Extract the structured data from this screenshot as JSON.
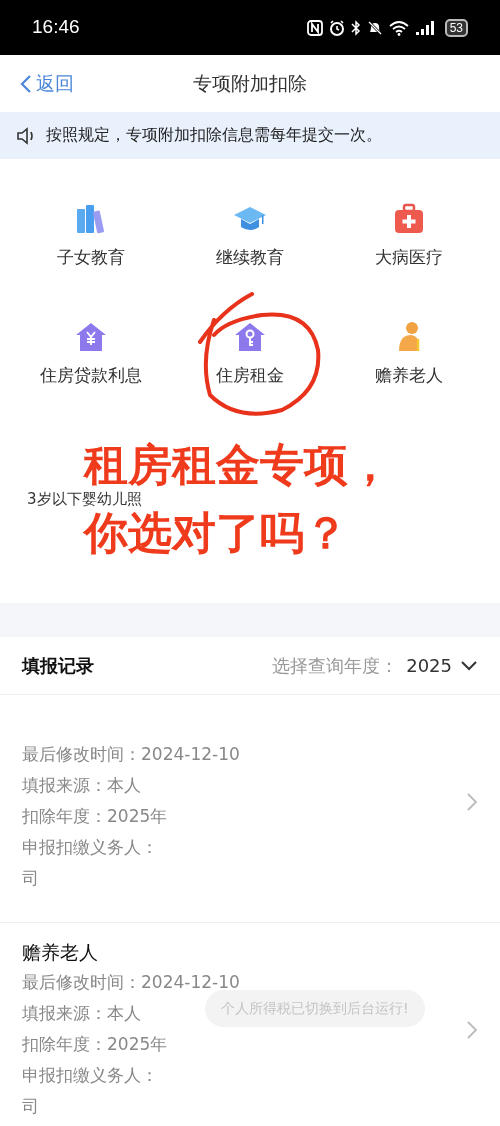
{
  "status_bar": {
    "time": "16:46",
    "battery": "53"
  },
  "nav": {
    "back": "返回",
    "title": "专项附加扣除"
  },
  "notice": "按照规定，专项附加扣除信息需每年提交一次。",
  "categories": [
    {
      "label": "子女教育"
    },
    {
      "label": "继续教育"
    },
    {
      "label": "大病医疗"
    },
    {
      "label": "住房贷款利息"
    },
    {
      "label": "住房租金",
      "circled": true
    },
    {
      "label": "赡养老人"
    }
  ],
  "partial_item": "3岁以下婴幼儿照",
  "annotation": [
    "租房租金专项，",
    "你选对了吗？"
  ],
  "records": {
    "title": "填报记录",
    "year_label": "选择查询年度：",
    "year": "2025",
    "items": [
      {
        "lines": [
          "最后修改时间：2024-12-10",
          "填报来源：本人",
          "扣除年度：2025年",
          "申报扣缴义务人：",
          "司"
        ]
      },
      {
        "title": "赡养老人",
        "lines": [
          "最后修改时间：2024-12-10",
          "填报来源：本人",
          "扣除年度：2025年",
          "申报扣缴义务人：",
          "司"
        ]
      }
    ]
  },
  "toast": "个人所得税已切换到后台运行!"
}
